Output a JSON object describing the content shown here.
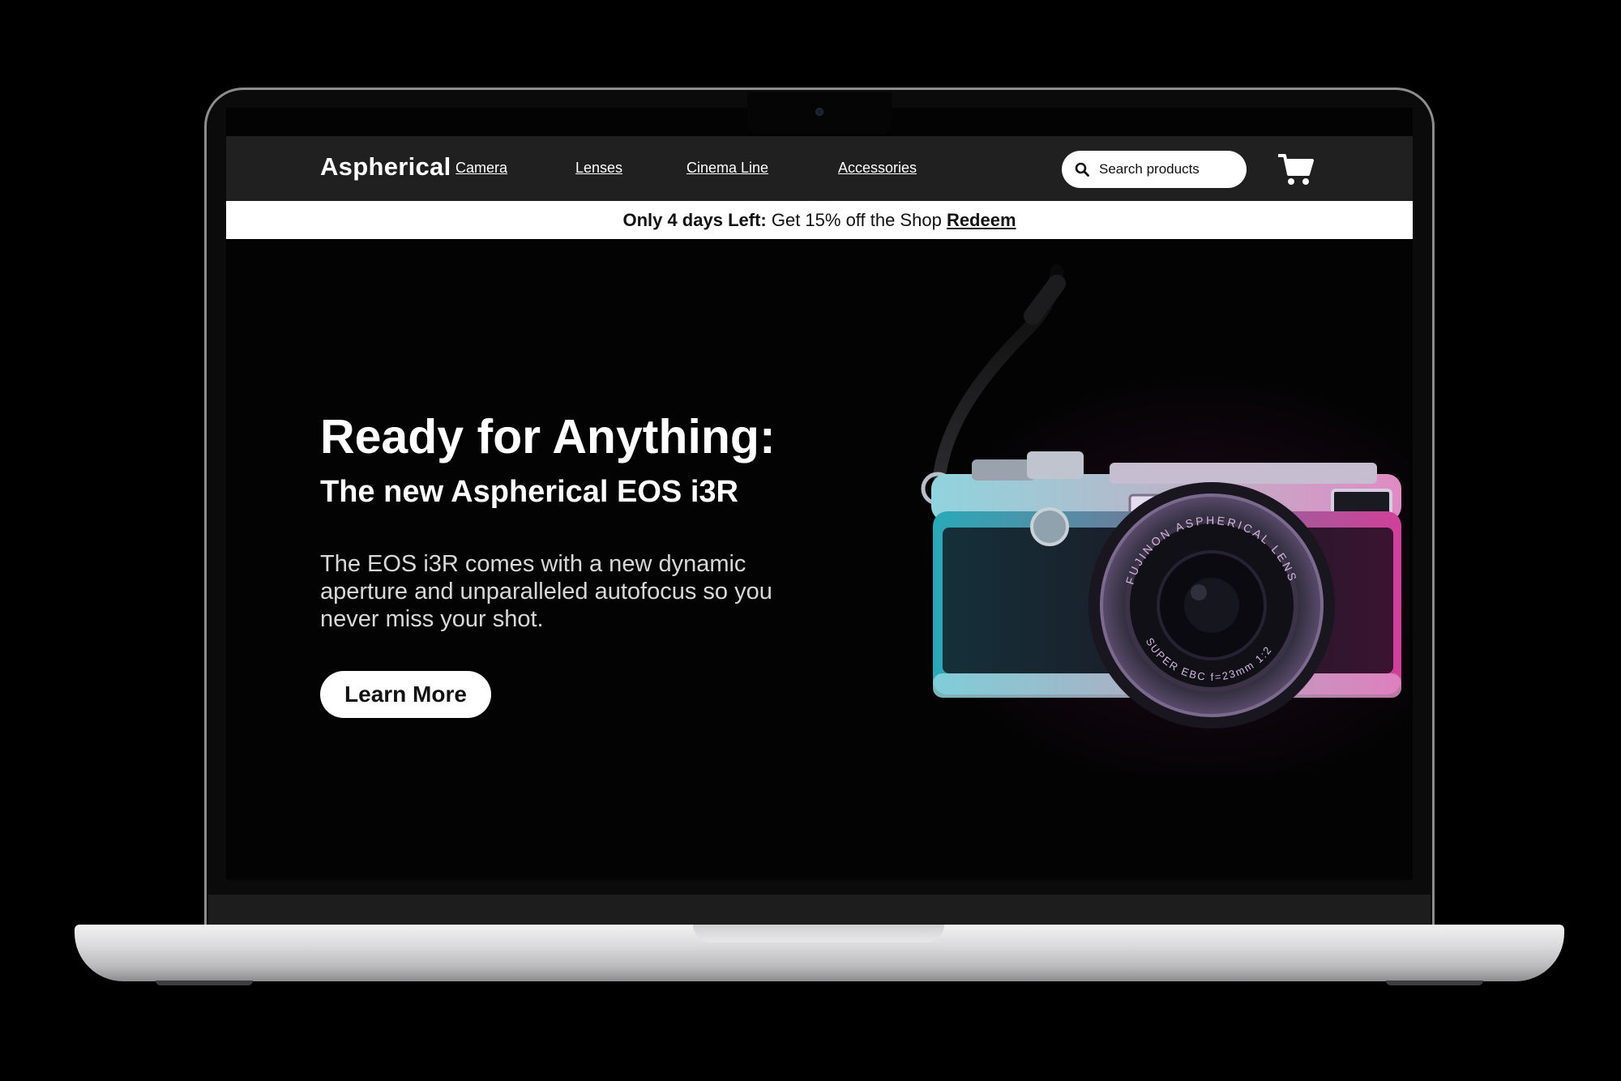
{
  "brand": {
    "name": "Aspherical"
  },
  "nav": {
    "items": [
      {
        "label": "Camera"
      },
      {
        "label": "Lenses"
      },
      {
        "label": "Cinema Line"
      },
      {
        "label": "Accessories"
      }
    ]
  },
  "search": {
    "placeholder": "Search products",
    "icon": "search-icon"
  },
  "cart": {
    "icon": "cart-icon"
  },
  "promo": {
    "bold_text": "Only 4 days Left:",
    "text": " Get 15% off the Shop ",
    "link": "Redeem"
  },
  "hero": {
    "title": "Ready for Anything:",
    "subtitle": "The new Aspherical EOS i3R",
    "description": "The  EOS i3R comes with a new dynamic aperture and unparalleled autofocus so you never miss your shot.",
    "cta": "Learn More",
    "camera_lens_text_top": "FUJINON ASPHERICAL LENS",
    "camera_lens_text_bottom": "SUPER EBC f=23mm 1:2"
  },
  "colors": {
    "page_bg": "#000000",
    "header_bg": "#202020",
    "promo_bg": "#ffffff",
    "accent_cyan": "#2ec4d6",
    "accent_magenta": "#d23aa0"
  }
}
